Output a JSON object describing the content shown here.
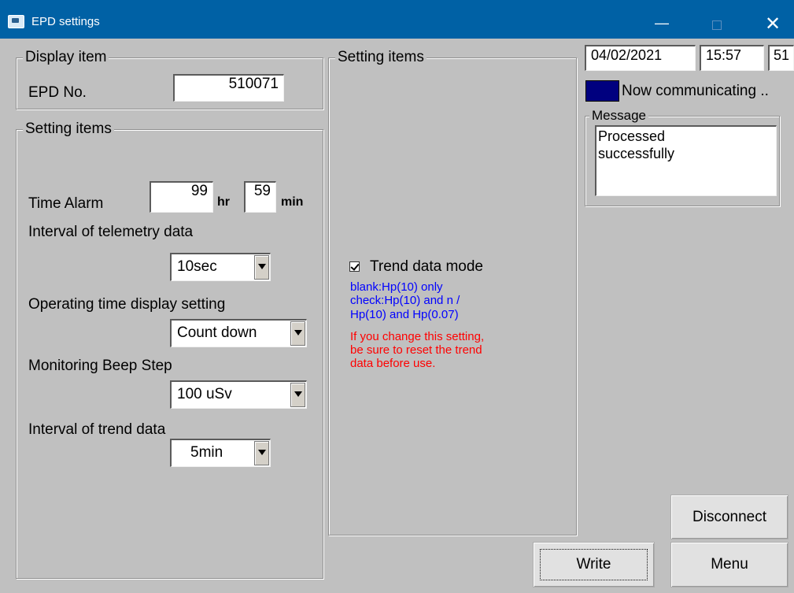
{
  "window": {
    "title": "EPD settings",
    "minimize_glyph": "—",
    "close_glyph": "✕"
  },
  "display_item": {
    "legend": "Display item",
    "epd_label": "EPD No.",
    "epd_value": "510071"
  },
  "settings": {
    "legend": "Setting items",
    "time_alarm_label": "Time Alarm",
    "time_alarm_hr": "99",
    "hr_unit": "hr",
    "time_alarm_min": "59",
    "min_unit": "min",
    "telemetry_label": "Interval of telemetry data",
    "telemetry_value": "10sec",
    "operating_label": "Operating time display setting",
    "operating_value": "Count down",
    "beep_label": "Monitoring Beep Step",
    "beep_value": "100 uSv",
    "trend_interval_label": "Interval of trend data",
    "trend_interval_value": "5min"
  },
  "setting_items_right": {
    "legend": "Setting items",
    "trend_mode_label": "Trend data mode",
    "trend_mode_checked": true,
    "blue_lines": [
      "blank:Hp(10) only",
      "check:Hp(10) and n /",
      "Hp(10) and Hp(0.07)"
    ],
    "red_lines": [
      "If you change this setting,",
      "be sure to reset the trend",
      "data before use."
    ]
  },
  "status": {
    "date": "04/02/2021",
    "time": "15:57",
    "extra": "51",
    "communication_text": "Now communicating ..",
    "message_legend": "Message",
    "message_text_1": "Processed",
    "message_text_2": "successfully"
  },
  "buttons": {
    "disconnect": "Disconnect",
    "write": "Write",
    "menu": "Menu"
  }
}
